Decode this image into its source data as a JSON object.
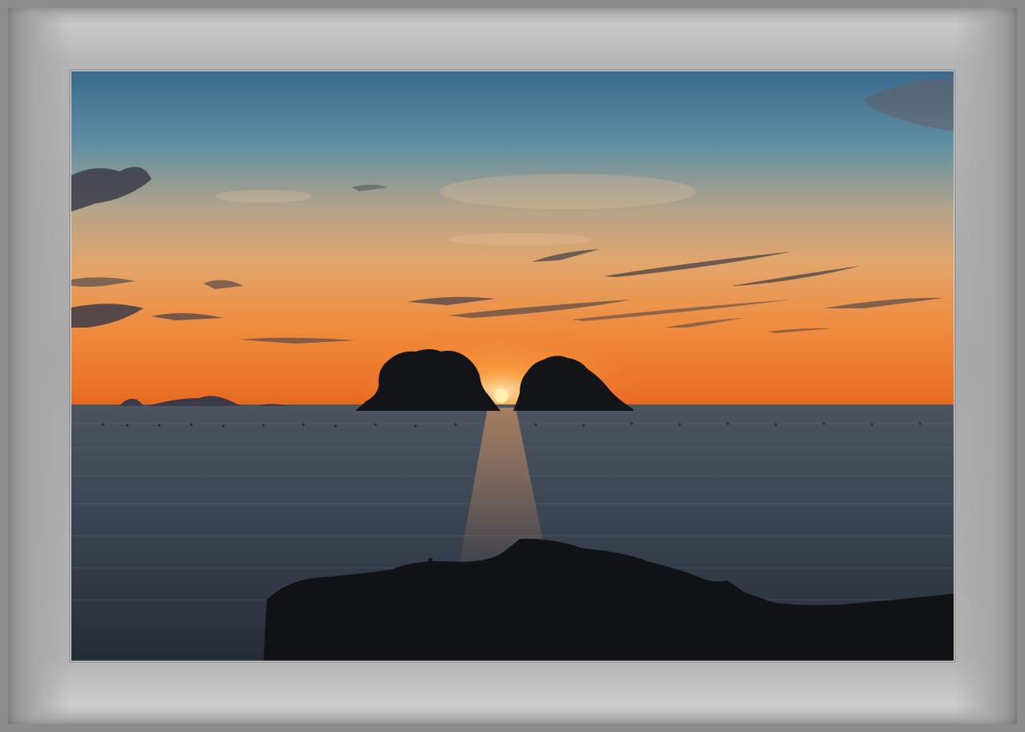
{
  "image": {
    "subject": "sunset-over-sea-with-islands",
    "colors": {
      "sky_top": "#3f6f8f",
      "sky_mid": "#c9a27a",
      "sky_horizon": "#f07a2a",
      "sun": "#ffe8a0",
      "sea": "#3a4656",
      "silhouette": "#121418",
      "frame": "#a9a9a9"
    }
  }
}
